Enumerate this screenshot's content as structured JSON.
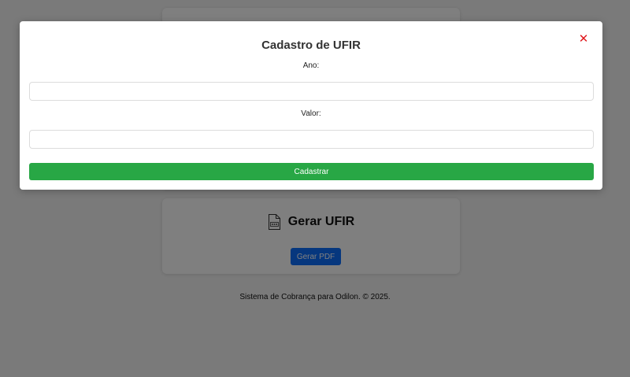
{
  "background": {
    "gerar_card": {
      "title": "Gerar UFIR",
      "icon": "pdf-file-icon",
      "button_label": "Gerar PDF"
    },
    "footer": "Sistema de Cobrança para Odilon. © 2025."
  },
  "modal": {
    "title": "Cadastro de UFIR",
    "close_icon": "close-icon",
    "fields": {
      "ano": {
        "label": "Ano:",
        "value": "",
        "placeholder": ""
      },
      "valor": {
        "label": "Valor:",
        "value": "",
        "placeholder": ""
      }
    },
    "submit_label": "Cadastrar"
  },
  "colors": {
    "submit": "#28a745",
    "primary": "#0d6efd",
    "close": "#e0191e",
    "overlay": "rgba(0,0,0,0.5)"
  }
}
